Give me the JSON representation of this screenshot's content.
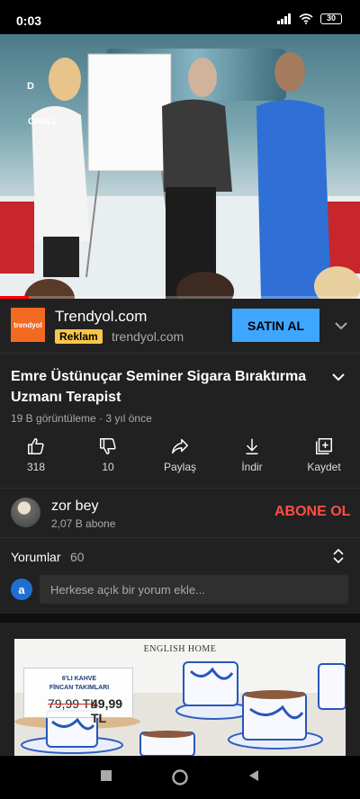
{
  "status_bar": {
    "time": "0:03",
    "battery": "30"
  },
  "video": {
    "channel_logo": "D",
    "live_label": "CANLI",
    "progress_fraction": 0.08
  },
  "ad": {
    "logo_text": "trendyol",
    "title": "Trendyol.com",
    "badge": "Reklam",
    "url": "trendyol.com",
    "cta": "SATIN AL"
  },
  "details": {
    "title": "Emre Üstünuçar Seminer Sigara Bıraktırma Uzmanı Terapist",
    "meta": "19 B görüntüleme · 3 yıl önce",
    "actions": [
      {
        "icon": "thumbs-up-icon",
        "label": "318"
      },
      {
        "icon": "thumbs-down-icon",
        "label": "10"
      },
      {
        "icon": "share-icon",
        "label": "Paylaş"
      },
      {
        "icon": "download-icon",
        "label": "İndir"
      },
      {
        "icon": "save-playlist-icon",
        "label": "Kaydet"
      }
    ]
  },
  "channel": {
    "name": "zor bey",
    "subscribers": "2,07 B abone",
    "subscribe_label": "ABONE OL"
  },
  "comments": {
    "heading": "Yorumlar",
    "count": "60",
    "avatar_letter": "a",
    "placeholder": "Herkese açık bir yorum ekle..."
  },
  "promo": {
    "brand": "ENGLISH HOME",
    "line1": "6'LI KAHVE",
    "line2": "FİNCAN TAKIMLARI",
    "old_price": "79,99 TL",
    "new_price": "49,99 TL"
  },
  "colors": {
    "accent_blue": "#3ea6ff",
    "subscribe_red": "#ff4e45",
    "badge_yellow": "#f9c647",
    "brand_orange": "#f26a21"
  }
}
